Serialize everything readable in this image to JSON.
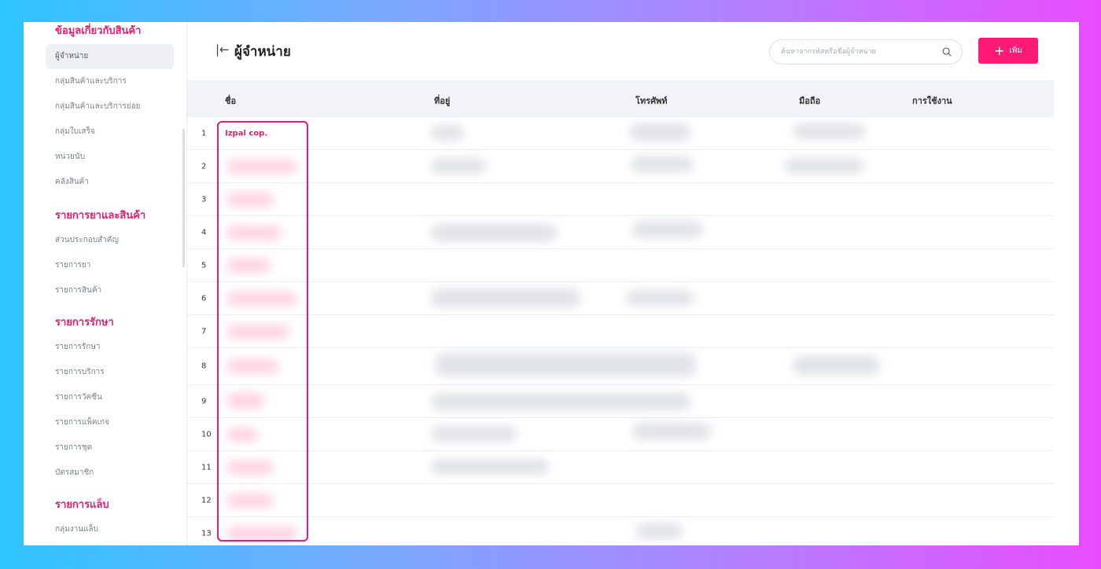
{
  "sidebar": {
    "sections": [
      {
        "title": "ข้อมูลเกี่ยวกับสินค้า",
        "items": [
          "ผู้จำหน่าย",
          "กลุ่มสินค้าและบริการ",
          "กลุ่มสินค้าและบริการย่อย",
          "กลุ่มใบเสร็จ",
          "หน่วยนับ",
          "คลังสินค้า"
        ]
      },
      {
        "title": "รายการยาและสินค้า",
        "items": [
          "ส่วนประกอบสำคัญ",
          "รายการยา",
          "รายการสินค้า"
        ]
      },
      {
        "title": "รายการรักษา",
        "items": [
          "รายการรักษา",
          "รายการบริการ",
          "รายการวัคซีน",
          "รายการแพ็คเกจ",
          "รายการชุด",
          "บัตรสมาชิก"
        ]
      },
      {
        "title": "รายการแล็บ",
        "items": [
          "กลุ่มงานแล็บ"
        ]
      }
    ],
    "active_item": "ผู้จำหน่าย"
  },
  "header": {
    "title": "ผู้จำหน่าย",
    "search_placeholder": "ค้นหาจากรหัสหรือชื่อผู้จำหน่าย",
    "add_label": "เพิ่ม"
  },
  "table": {
    "columns": [
      "ชื่อ",
      "ที่อยู่",
      "โทรศัพท์",
      "มือถือ",
      "การใช้งาน"
    ],
    "rows": [
      {
        "index": "1",
        "name": "Izpal cop."
      },
      {
        "index": "2",
        "name": ""
      },
      {
        "index": "3",
        "name": ""
      },
      {
        "index": "4",
        "name": ""
      },
      {
        "index": "5",
        "name": ""
      },
      {
        "index": "6",
        "name": ""
      },
      {
        "index": "7",
        "name": ""
      },
      {
        "index": "8",
        "name": ""
      },
      {
        "index": "9",
        "name": ""
      },
      {
        "index": "10",
        "name": ""
      },
      {
        "index": "11",
        "name": ""
      },
      {
        "index": "12",
        "name": ""
      },
      {
        "index": "13",
        "name": ""
      }
    ]
  },
  "colors": {
    "accent": "#ff1a78",
    "section_title": "#e0206e",
    "highlight_border": "#e81c78"
  },
  "icons": {
    "back": "collapse-left-icon",
    "search": "search-icon",
    "add": "plus-icon"
  }
}
